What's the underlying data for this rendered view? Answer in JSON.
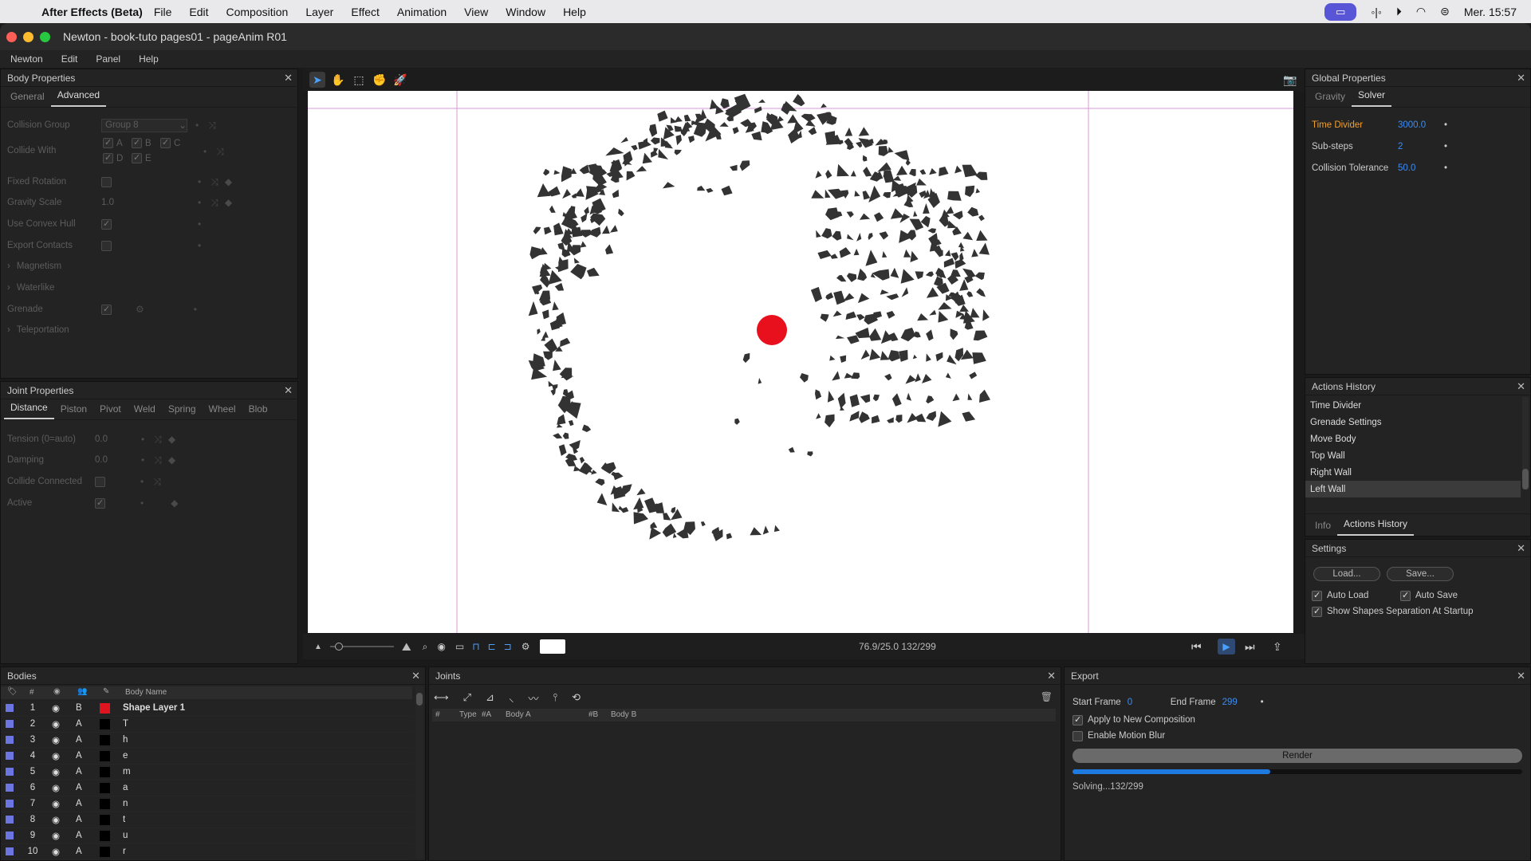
{
  "menubar": {
    "app_name": "After Effects (Beta)",
    "items": [
      "File",
      "Edit",
      "Composition",
      "Layer",
      "Effect",
      "Animation",
      "View",
      "Window",
      "Help"
    ],
    "clock": "Mer. 15:57"
  },
  "window": {
    "title": "Newton - book-tuto pages01 - pageAnim R01"
  },
  "app_menu": [
    "Newton",
    "Edit",
    "Panel",
    "Help"
  ],
  "body_properties": {
    "title": "Body Properties",
    "tabs": [
      "General",
      "Advanced"
    ],
    "collision_group_label": "Collision Group",
    "collision_group_value": "Group 8",
    "collide_with_label": "Collide With",
    "collide_letters": [
      "A",
      "B",
      "C",
      "D",
      "E"
    ],
    "fixed_rotation_label": "Fixed Rotation",
    "gravity_scale_label": "Gravity Scale",
    "gravity_scale_value": "1.0",
    "use_convex_hull_label": "Use Convex Hull",
    "export_contacts_label": "Export Contacts",
    "magnetism_label": "Magnetism",
    "waterlike_label": "Waterlike",
    "grenade_label": "Grenade",
    "teleportation_label": "Teleportation"
  },
  "joint_properties": {
    "title": "Joint Properties",
    "tabs": [
      "Distance",
      "Piston",
      "Pivot",
      "Weld",
      "Spring",
      "Wheel",
      "Blob"
    ],
    "tension_label": "Tension (0=auto)",
    "tension_value": "0.0",
    "damping_label": "Damping",
    "damping_value": "0.0",
    "collide_connected_label": "Collide Connected",
    "active_label": "Active"
  },
  "viewer": {
    "status": "76.9/25.0  132/299"
  },
  "global_properties": {
    "title": "Global Properties",
    "tabs": [
      "Gravity",
      "Solver"
    ],
    "time_divider_label": "Time Divider",
    "time_divider_value": "3000.0",
    "substeps_label": "Sub-steps",
    "substeps_value": "2",
    "collision_tolerance_label": "Collision Tolerance",
    "collision_tolerance_value": "50.0"
  },
  "actions_history": {
    "title": "Actions History",
    "items": [
      "Time Divider",
      "Grenade Settings",
      "Move Body",
      "Top Wall",
      "Right Wall",
      "Left Wall"
    ],
    "tabs": [
      "Info",
      "Actions History"
    ]
  },
  "settings": {
    "title": "Settings",
    "load_label": "Load...",
    "save_label": "Save...",
    "auto_load_label": "Auto Load",
    "auto_save_label": "Auto Save",
    "show_shapes_label": "Show Shapes Separation At Startup"
  },
  "bodies": {
    "title": "Bodies",
    "header_body_name": "Body Name",
    "header_hash": "#",
    "rows": [
      {
        "num": "1",
        "type": "B",
        "color": "#e0141e",
        "name": "Shape Layer 1"
      },
      {
        "num": "2",
        "type": "A",
        "color": "#000000",
        "name": "T"
      },
      {
        "num": "3",
        "type": "A",
        "color": "#000000",
        "name": "h"
      },
      {
        "num": "4",
        "type": "A",
        "color": "#000000",
        "name": "e"
      },
      {
        "num": "5",
        "type": "A",
        "color": "#000000",
        "name": "m"
      },
      {
        "num": "6",
        "type": "A",
        "color": "#000000",
        "name": "a"
      },
      {
        "num": "7",
        "type": "A",
        "color": "#000000",
        "name": "n"
      },
      {
        "num": "8",
        "type": "A",
        "color": "#000000",
        "name": "t"
      },
      {
        "num": "9",
        "type": "A",
        "color": "#000000",
        "name": "u"
      },
      {
        "num": "10",
        "type": "A",
        "color": "#000000",
        "name": "r"
      }
    ]
  },
  "joints": {
    "title": "Joints",
    "columns": [
      "#",
      "Type",
      "#A",
      "Body A",
      "#B",
      "Body B"
    ]
  },
  "export": {
    "title": "Export",
    "start_frame_label": "Start Frame",
    "start_frame_value": "0",
    "end_frame_label": "End Frame",
    "end_frame_value": "299",
    "apply_label": "Apply to New Composition",
    "motion_blur_label": "Enable Motion Blur",
    "render_label": "Render",
    "progress": 0.44,
    "status": "Solving...132/299"
  },
  "colors": {
    "accent": "#3d8cf0",
    "orange": "#f0a030",
    "red_ball": "#e8101c"
  }
}
